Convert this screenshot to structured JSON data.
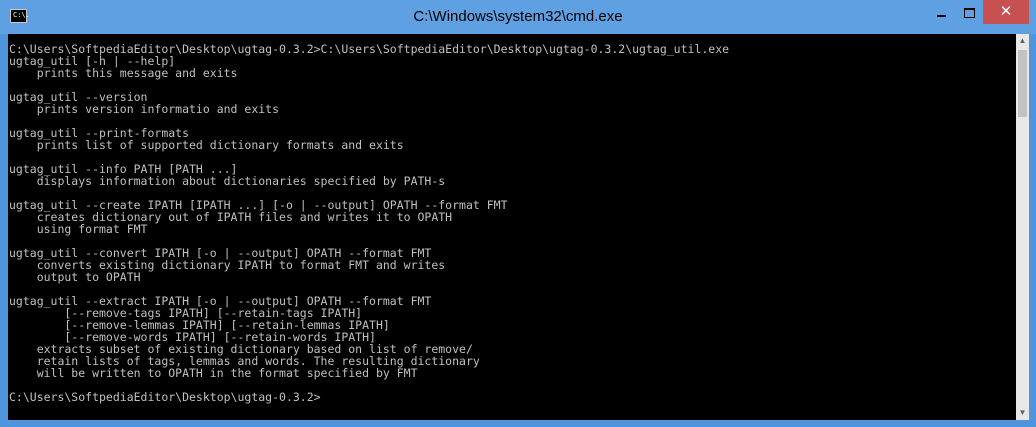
{
  "window": {
    "title": "C:\\Windows\\system32\\cmd.exe",
    "icon_text": "C:\\.",
    "accent_color": "#5fa0e3",
    "close_color": "#c75050",
    "minimize_glyph": "",
    "maximize_glyph": "",
    "close_glyph": "✕"
  },
  "console": {
    "background": "#000000",
    "foreground": "#c0c0c0",
    "lines": [
      "C:\\Users\\SoftpediaEditor\\Desktop\\ugtag-0.3.2>C:\\Users\\SoftpediaEditor\\Desktop\\ugtag-0.3.2\\ugtag_util.exe",
      "ugtag_util [-h | --help]",
      "    prints this message and exits",
      "",
      "ugtag_util --version",
      "    prints version informatio and exits",
      "",
      "ugtag_util --print-formats",
      "    prints list of supported dictionary formats and exits",
      "",
      "ugtag_util --info PATH [PATH ...]",
      "    displays information about dictionaries specified by PATH-s",
      "",
      "ugtag_util --create IPATH [IPATH ...] [-o | --output] OPATH --format FMT",
      "    creates dictionary out of IPATH files and writes it to OPATH",
      "    using format FMT",
      "",
      "ugtag_util --convert IPATH [-o | --output] OPATH --format FMT",
      "    converts existing dictionary IPATH to format FMT and writes",
      "    output to OPATH",
      "",
      "ugtag_util --extract IPATH [-o | --output] OPATH --format FMT",
      "        [--remove-tags IPATH] [--retain-tags IPATH]",
      "        [--remove-lemmas IPATH] [--retain-lemmas IPATH]",
      "        [--remove-words IPATH] [--retain-words IPATH]",
      "    extracts subset of existing dictionary based on list of remove/",
      "    retain lists of tags, lemmas and words. The resulting dictionary",
      "    will be written to OPATH in the format specified by FMT",
      "",
      "C:\\Users\\SoftpediaEditor\\Desktop\\ugtag-0.3.2>"
    ]
  },
  "scrollbar": {
    "up_glyph": "▲",
    "down_glyph": "▼"
  }
}
